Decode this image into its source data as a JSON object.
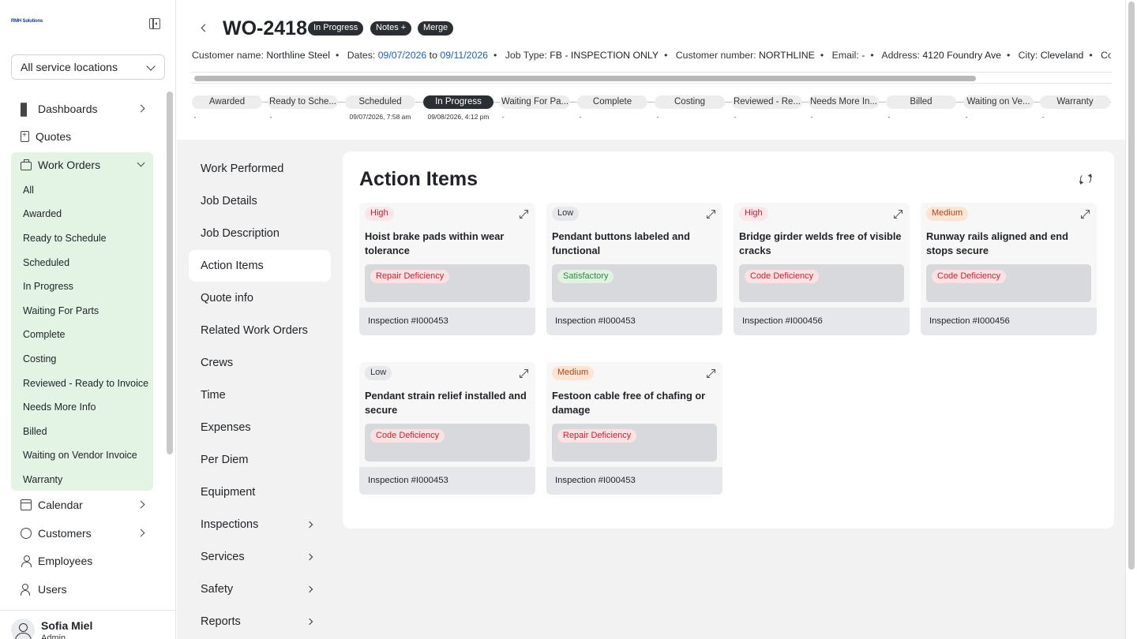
{
  "sidebar": {
    "logo_text": "RMH Solutions",
    "location_select": "All service locations",
    "items": [
      {
        "label": "Dashboards",
        "icon": "grid-icon"
      },
      {
        "label": "Quotes",
        "icon": "document-plus-icon"
      },
      {
        "label": "Work Orders",
        "icon": "briefcase-icon"
      },
      {
        "label": "Calendar",
        "icon": "calendar-icon"
      },
      {
        "label": "Customers",
        "icon": "chat-icon"
      },
      {
        "label": "Employees",
        "icon": "user-icon"
      },
      {
        "label": "Users",
        "icon": "users-icon"
      }
    ],
    "work_order_sub": [
      "All",
      "Awarded",
      "Ready to Schedule",
      "Scheduled",
      "In Progress",
      "Waiting For Parts",
      "Complete",
      "Costing",
      "Reviewed - Ready to Invoice",
      "Needs More Info",
      "Billed",
      "Waiting on Vendor Invoice",
      "Warranty"
    ],
    "user": {
      "name": "Sofia Miel",
      "role": "Admin"
    }
  },
  "header": {
    "title": "WO-2418",
    "pills": [
      "In Progress",
      "Notes +",
      "Merge"
    ],
    "info": {
      "customer_label": "Customer name:",
      "customer": "Northline Steel",
      "dates_label": "Dates:",
      "date_from": "09/07/2026",
      "date_to_word": "to",
      "date_to": "09/11/2026",
      "job_type_label": "Job Type:",
      "job_type": "FB - INSPECTION ONLY",
      "cust_no_label": "Customer number:",
      "cust_no": "NORTHLINE",
      "email_label": "Email:",
      "email": "-",
      "address_label": "Address:",
      "address": "4120 Foundry Ave",
      "city_label": "City:",
      "city": "Cleveland",
      "county_label": "Coun"
    },
    "dot": "•",
    "stages": [
      {
        "label": "Awarded",
        "date": "-"
      },
      {
        "label": "Ready to Sche...",
        "date": "-"
      },
      {
        "label": "Scheduled",
        "date": "09/07/2026, 7:58 am"
      },
      {
        "label": "In Progress",
        "date": "09/08/2026, 4:12 pm"
      },
      {
        "label": "Waiting For Pa...",
        "date": "-"
      },
      {
        "label": "Complete",
        "date": "-"
      },
      {
        "label": "Costing",
        "date": "-"
      },
      {
        "label": "Reviewed - Re...",
        "date": "-"
      },
      {
        "label": "Needs More In...",
        "date": "-"
      },
      {
        "label": "Billed",
        "date": "-"
      },
      {
        "label": "Waiting on Ve...",
        "date": "-"
      },
      {
        "label": "Warranty",
        "date": "-"
      }
    ]
  },
  "subnav": [
    {
      "label": "Work Performed"
    },
    {
      "label": "Job Details"
    },
    {
      "label": "Job Description"
    },
    {
      "label": "Action Items"
    },
    {
      "label": "Quote info"
    },
    {
      "label": "Related Work Orders"
    },
    {
      "label": "Crews"
    },
    {
      "label": "Time"
    },
    {
      "label": "Expenses"
    },
    {
      "label": "Per Diem"
    },
    {
      "label": "Equipment"
    },
    {
      "label": "Inspections"
    },
    {
      "label": "Services"
    },
    {
      "label": "Safety"
    },
    {
      "label": "Reports"
    }
  ],
  "panel": {
    "title": "Action Items",
    "cards": [
      {
        "priority": "High",
        "title": "Hoist brake pads within wear tolerance",
        "deficiency": "Repair Deficiency",
        "inspection": "Inspection #I000453"
      },
      {
        "priority": "Low",
        "title": "Pendant buttons labeled and functional",
        "deficiency": "Satisfactory",
        "inspection": "Inspection #I000453"
      },
      {
        "priority": "High",
        "title": "Bridge girder welds free of visible cracks",
        "deficiency": "Code Deficiency",
        "inspection": "Inspection #I000456"
      },
      {
        "priority": "Medium",
        "title": "Runway rails aligned and end stops secure",
        "deficiency": "Code Deficiency",
        "inspection": "Inspection #I000456"
      },
      {
        "priority": "Low",
        "title": "Pendant strain relief installed and secure",
        "deficiency": "Code Deficiency",
        "inspection": "Inspection #I000453"
      },
      {
        "priority": "Medium",
        "title": "Festoon cable free of chafing or damage",
        "deficiency": "Repair Deficiency",
        "inspection": "Inspection #I000453"
      }
    ]
  }
}
